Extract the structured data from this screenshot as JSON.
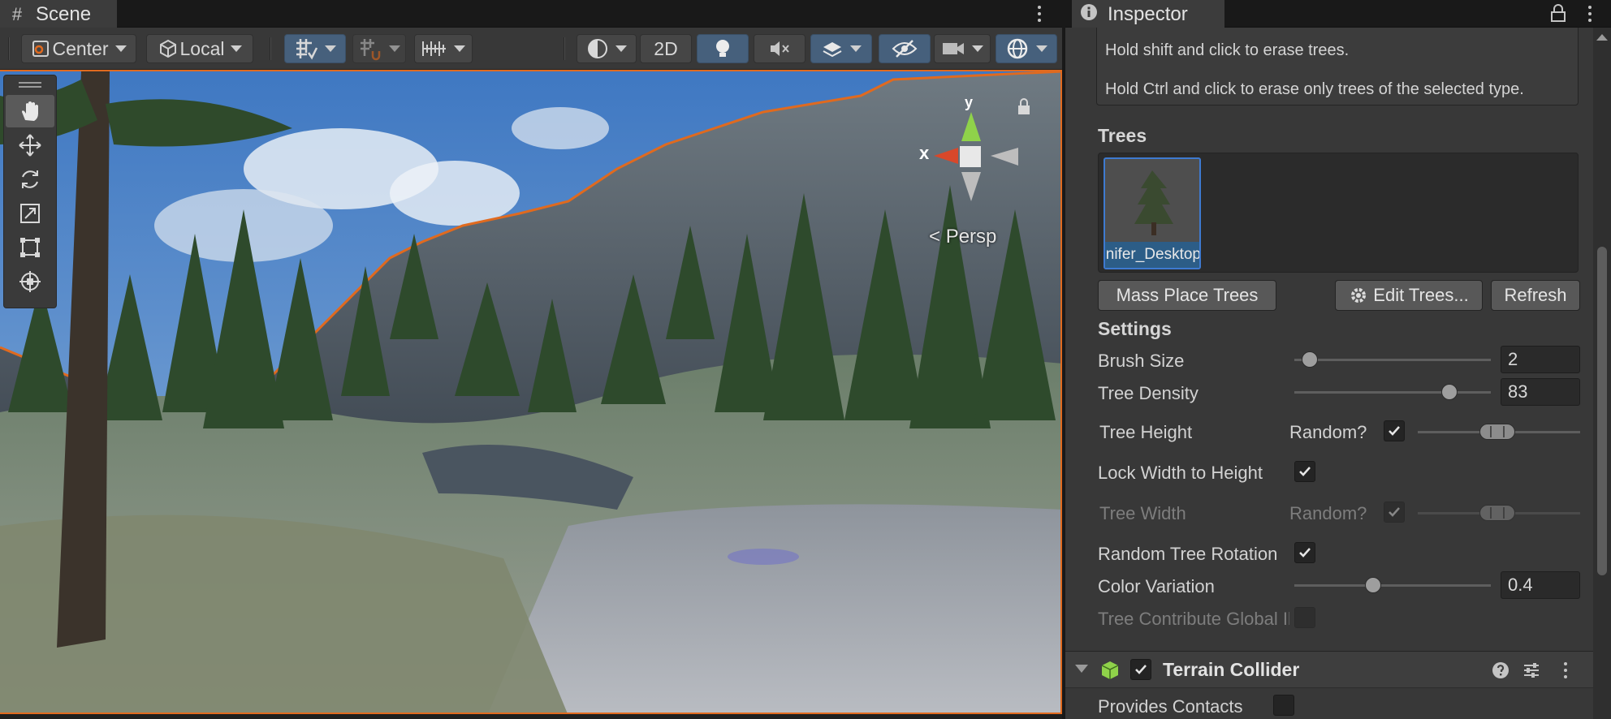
{
  "scene": {
    "tab_title": "Scene",
    "toolbar": {
      "pivot_label": "Center",
      "space_label": "Local",
      "mode_2d_label": "2D"
    },
    "view_label": "Persp",
    "gizmo_axes": {
      "x": "x",
      "y": "y"
    }
  },
  "inspector": {
    "tab_title": "Inspector",
    "help_lines": [
      "Hold shift and click to erase trees.",
      "Hold Ctrl and click to erase only trees of the selected type."
    ],
    "trees_header": "Trees",
    "tree_item_label": "Conifer_Desktop",
    "buttons": {
      "mass_place": "Mass Place Trees",
      "edit_trees": "Edit Trees...",
      "refresh": "Refresh"
    },
    "settings_header": "Settings",
    "settings": {
      "brush_size_label": "Brush Size",
      "brush_size_value": "2",
      "brush_size_fraction": 0.08,
      "tree_density_label": "Tree Density",
      "tree_density_value": "83",
      "tree_density_fraction": 0.79,
      "tree_height_label": "Tree Height",
      "random_label": "Random?",
      "lock_width_label": "Lock Width to Height",
      "tree_width_label": "Tree Width",
      "random_rotation_label": "Random Tree Rotation",
      "color_variation_label": "Color Variation",
      "color_variation_value": "0.4",
      "color_variation_fraction": 0.4,
      "contribute_gi_label": "Tree Contribute Global Illumination"
    },
    "component": {
      "title": "Terrain Collider",
      "provides_contacts_label": "Provides Contacts"
    }
  },
  "colors": {
    "accent_blue": "#46607c",
    "selection_outline": "#e06a1f",
    "panel_bg": "#383838"
  }
}
